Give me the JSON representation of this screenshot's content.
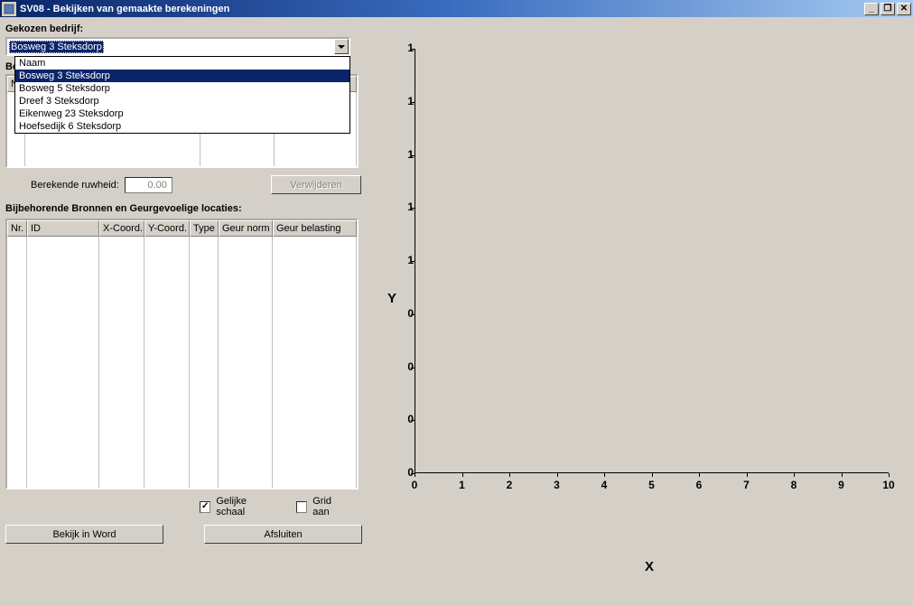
{
  "window": {
    "title": "SV08 - Bekijken van gemaakte berekeningen",
    "minimize_glyph": "_",
    "restore_glyph": "❐",
    "close_glyph": "✕"
  },
  "section_company": {
    "label": "Gekozen bedrijf:",
    "selected": "Bosweg 3 Steksdorp",
    "dropdown_header": "Naam",
    "options": [
      "Bosweg 3 Steksdorp",
      "Bosweg 5 Steksdorp",
      "Dreef 3 Steksdorp",
      "Eikenweg 23 Steksdorp",
      "Hoefsedijk 6 Steksdorp"
    ]
  },
  "section_calc": {
    "truncated_label": "Be",
    "hidden_header": "Na"
  },
  "ruwheid": {
    "label": "Berekende ruwheid:",
    "value": "0.00",
    "remove_btn": "Verwijderen"
  },
  "section_sources": {
    "label": "Bijbehorende Bronnen en Geurgevoelige locaties:",
    "columns": [
      "Nr.",
      "ID",
      "X-Coord.",
      "Y-Coord.",
      "Type",
      "Geur norm",
      "Geur belasting"
    ]
  },
  "checkboxes": {
    "equal_scale": "Gelijke schaal",
    "grid_on": "Grid aan"
  },
  "buttons": {
    "word": "Bekijk in Word",
    "close": "Afsluiten"
  },
  "chart_data": {
    "type": "scatter",
    "title": "",
    "xlabel": "X",
    "ylabel": "Y",
    "x_ticks": [
      0,
      1,
      2,
      3,
      4,
      5,
      6,
      7,
      8,
      9,
      10
    ],
    "y_ticks_labels": [
      "0",
      "0",
      "0",
      "0",
      "1",
      "1",
      "1",
      "1",
      "1"
    ],
    "y_tick_positions": [
      0,
      0.125,
      0.25,
      0.375,
      0.5,
      0.625,
      0.75,
      0.875,
      1.0
    ],
    "xlim": [
      0,
      10
    ],
    "ylim": [
      0,
      1
    ],
    "series": []
  }
}
